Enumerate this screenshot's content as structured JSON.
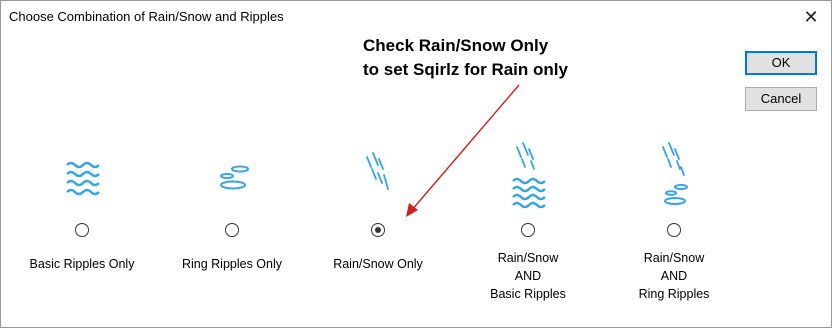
{
  "window": {
    "title": "Choose Combination of Rain/Snow and Ripples",
    "close_symbol": "✕"
  },
  "annotation": {
    "line1": "Check Rain/Snow Only",
    "line2": "to set Sqirlz for Rain only",
    "arrow_color": "#d01f1f"
  },
  "buttons": {
    "ok": "OK",
    "cancel": "Cancel"
  },
  "accent_color": "#3aa3e3",
  "options": [
    {
      "line1": "Basic Ripples Only",
      "selected": false,
      "icon": "basic-ripples-icon"
    },
    {
      "line1": "Ring Ripples Only",
      "selected": false,
      "icon": "ring-ripples-icon"
    },
    {
      "line1": "Rain/Snow Only",
      "selected": true,
      "icon": "rain-snow-icon"
    },
    {
      "line1": "Rain/Snow",
      "line2": "AND",
      "line3": "Basic Ripples",
      "selected": false,
      "icon": "rain-basic-ripples-icon"
    },
    {
      "line1": "Rain/Snow",
      "line2": "AND",
      "line3": "Ring Ripples",
      "selected": false,
      "icon": "rain-ring-ripples-icon"
    }
  ]
}
